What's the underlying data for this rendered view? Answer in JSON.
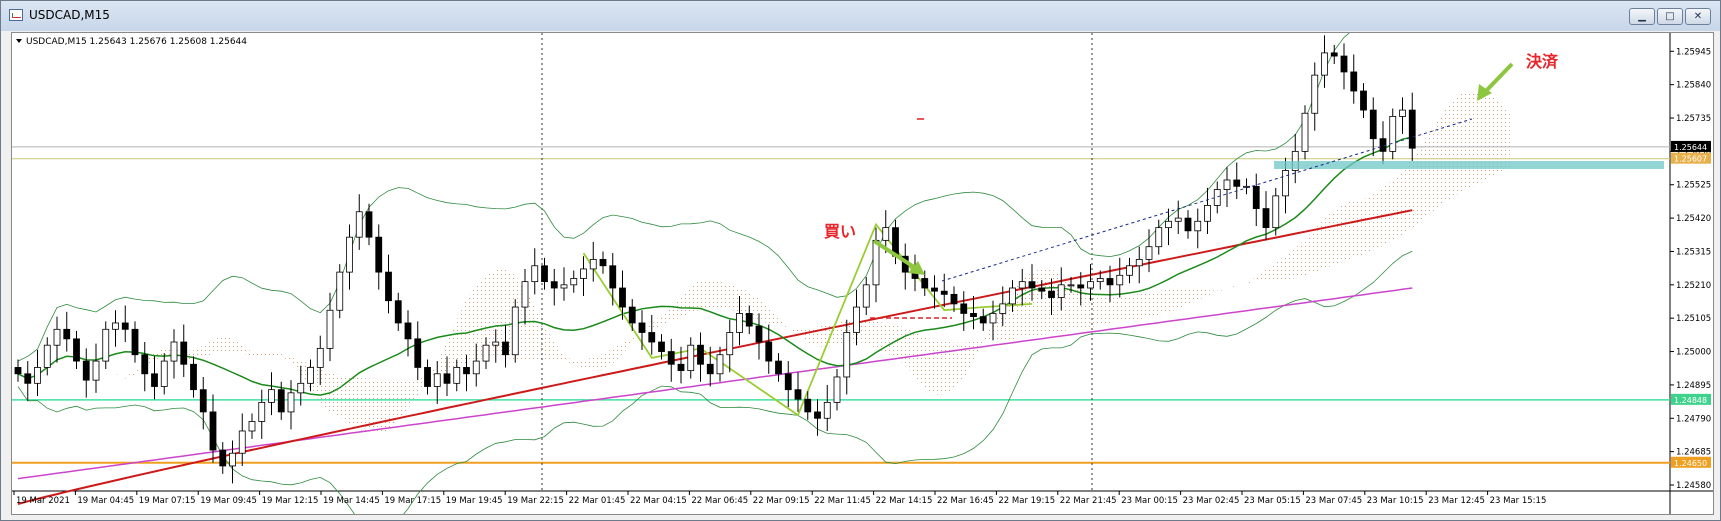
{
  "window": {
    "title": "USDCAD,M15",
    "buttons": {
      "minimize": "▁",
      "maximize": "□",
      "close": "✕"
    }
  },
  "chart_header": {
    "symbol_info": "USDCAD,M15  1.25643 1.25676 1.25608 1.25644"
  },
  "annotations": {
    "buy_label": "買い",
    "settle_label": "決済"
  },
  "colors": {
    "bull_candle": "#ffffff",
    "bear_candle": "#000000",
    "ma_short": "#1a8a1a",
    "ma_mid": "#cc1a1a",
    "ma_long": "#cc44cc",
    "bollinger": "#2e8b3e",
    "ichimoku_cloud": "#d2a070",
    "zigzag": "#9acd32",
    "annotation_text": "#e8252a",
    "arrow": "#8dc63f",
    "level_teal": "#40e0a0",
    "level_orange": "#f0a020",
    "level_olive": "#c8c87a",
    "zone_teal": "#6fc7c7"
  },
  "chart_data": {
    "type": "candlestick",
    "symbol": "USDCAD",
    "timeframe": "M15",
    "last_ohlc": {
      "open": 1.25643,
      "high": 1.25676,
      "low": 1.25608,
      "close": 1.25644
    },
    "y_ticks": [
      1.25945,
      1.2584,
      1.25735,
      1.2563,
      1.25525,
      1.2542,
      1.25315,
      1.2521,
      1.25105,
      1.25,
      1.24895,
      1.2479,
      1.24685,
      1.2458
    ],
    "ylim": [
      1.2458,
      1.2599
    ],
    "x_ticks": [
      "19 Mar 2021",
      "19 Mar 04:45",
      "19 Mar 07:15",
      "19 Mar 09:45",
      "19 Mar 12:15",
      "19 Mar 14:45",
      "19 Mar 17:15",
      "19 Mar 19:45",
      "19 Mar 22:15",
      "22 Mar 01:45",
      "22 Mar 04:15",
      "22 Mar 06:45",
      "22 Mar 09:15",
      "22 Mar 11:45",
      "22 Mar 14:15",
      "22 Mar 16:45",
      "22 Mar 19:15",
      "22 Mar 21:45",
      "23 Mar 00:15",
      "23 Mar 02:45",
      "23 Mar 05:15",
      "23 Mar 07:45",
      "23 Mar 10:15",
      "23 Mar 12:45",
      "23 Mar 15:15"
    ],
    "price_labels": [
      {
        "value": 1.25644,
        "text": "1.25644",
        "bg": "#000000",
        "fg": "#ffffff"
      },
      {
        "value": 1.25607,
        "text": "1.25607",
        "bg": "#e8b04a",
        "fg": "#ffffff"
      },
      {
        "value": 1.24848,
        "text": "1.24848",
        "bg": "#3fd28c",
        "fg": "#ffffff"
      },
      {
        "value": 1.2465,
        "text": "1.24650",
        "bg": "#f0a020",
        "fg": "#ffffff"
      }
    ],
    "horizontal_levels": [
      {
        "value": 1.25644,
        "color": "#b0b0b0",
        "width": 1
      },
      {
        "value": 1.25607,
        "color": "#c8c87a",
        "width": 1
      },
      {
        "value": 1.24848,
        "color": "#40e0a0",
        "width": 1.5
      },
      {
        "value": 1.2465,
        "color": "#f0a020",
        "width": 2
      }
    ],
    "close": [
      1.2493,
      1.249,
      1.2495,
      1.2502,
      1.2507,
      1.2504,
      1.2497,
      1.2491,
      1.2497,
      1.2507,
      1.2509,
      1.2507,
      1.2499,
      1.2493,
      1.2489,
      1.2497,
      1.2503,
      1.2496,
      1.2488,
      1.2481,
      1.2469,
      1.2464,
      1.2468,
      1.2475,
      1.2478,
      1.2484,
      1.2488,
      1.2481,
      1.2487,
      1.249,
      1.2495,
      1.2501,
      1.2513,
      1.2525,
      1.2536,
      1.2544,
      1.2536,
      1.2525,
      1.2516,
      1.2509,
      1.2504,
      1.2495,
      1.2489,
      1.2493,
      1.249,
      1.2495,
      1.2493,
      1.2497,
      1.2502,
      1.2503,
      1.2499,
      1.2514,
      1.2522,
      1.2527,
      1.2522,
      1.252,
      1.2521,
      1.2523,
      1.2526,
      1.2529,
      1.2527,
      1.252,
      1.2514,
      1.2509,
      1.2506,
      1.2503,
      1.25,
      1.2496,
      1.2494,
      1.2502,
      1.2496,
      1.2493,
      1.2499,
      1.2506,
      1.2512,
      1.2508,
      1.2503,
      1.2497,
      1.2493,
      1.2488,
      1.2485,
      1.2481,
      1.2479,
      1.2484,
      1.2492,
      1.2506,
      1.2514,
      1.2521,
      1.2535,
      1.2539,
      1.253,
      1.2525,
      1.2523,
      1.252,
      1.2519,
      1.2518,
      1.2515,
      1.2512,
      1.2511,
      1.2509,
      1.2512,
      1.2515,
      1.252,
      1.2522,
      1.252,
      1.2519,
      1.2517,
      1.2521,
      1.2521,
      1.252,
      1.2522,
      1.2523,
      1.2521,
      1.2524,
      1.2527,
      1.2529,
      1.2533,
      1.2539,
      1.2541,
      1.2542,
      1.2538,
      1.2541,
      1.2546,
      1.2551,
      1.2554,
      1.2552,
      1.2552,
      1.2545,
      1.2539,
      1.2549,
      1.2557,
      1.2563,
      1.2575,
      1.2587,
      1.2594,
      1.2593,
      1.2588,
      1.2582,
      1.2576,
      1.2567,
      1.2563,
      1.2574,
      1.2576,
      1.2564
    ]
  }
}
